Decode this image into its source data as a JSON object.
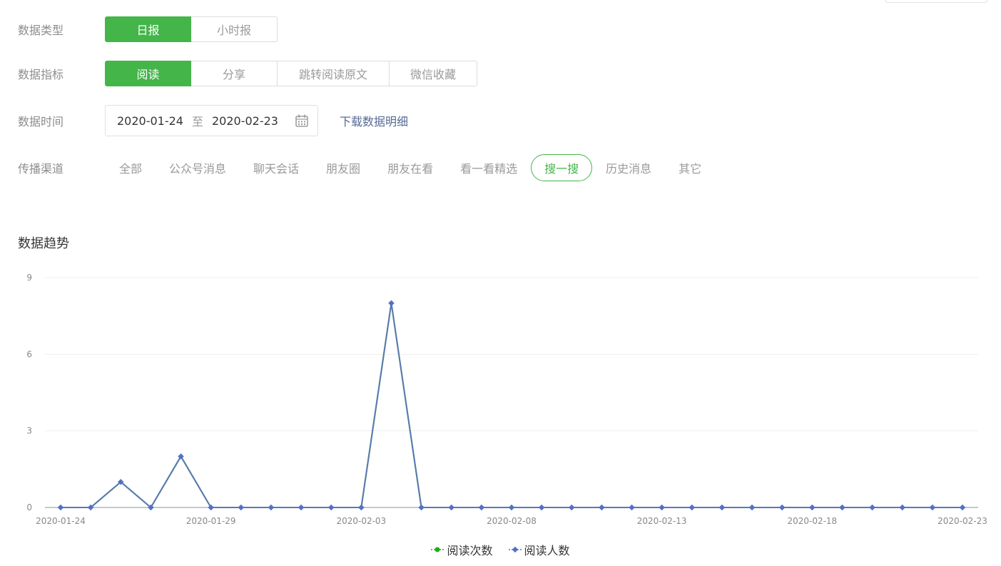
{
  "filters": {
    "data_type": {
      "label": "数据类型",
      "options": [
        "日报",
        "小时报"
      ],
      "active": 0
    },
    "metric": {
      "label": "数据指标",
      "options": [
        "阅读",
        "分享",
        "跳转阅读原文",
        "微信收藏"
      ],
      "active": 0
    },
    "time": {
      "label": "数据时间",
      "start": "2020-01-24",
      "separator": "至",
      "end": "2020-02-23",
      "download_label": "下载数据明细"
    },
    "channel": {
      "label": "传播渠道",
      "options": [
        "全部",
        "公众号消息",
        "聊天会话",
        "朋友圈",
        "朋友在看",
        "看一看精选",
        "搜一搜",
        "历史消息",
        "其它"
      ],
      "active": 6
    }
  },
  "trend": {
    "title": "数据趋势"
  },
  "colors": {
    "accent": "#44b549",
    "link": "#576b95",
    "series_reads": "#1aad19",
    "series_readers": "#5470c6"
  },
  "chart_data": {
    "type": "line",
    "x": [
      "2020-01-24",
      "2020-01-25",
      "2020-01-26",
      "2020-01-27",
      "2020-01-28",
      "2020-01-29",
      "2020-01-30",
      "2020-01-31",
      "2020-02-01",
      "2020-02-02",
      "2020-02-03",
      "2020-02-04",
      "2020-02-05",
      "2020-02-06",
      "2020-02-07",
      "2020-02-08",
      "2020-02-09",
      "2020-02-10",
      "2020-02-11",
      "2020-02-12",
      "2020-02-13",
      "2020-02-14",
      "2020-02-15",
      "2020-02-16",
      "2020-02-17",
      "2020-02-18",
      "2020-02-19",
      "2020-02-20",
      "2020-02-21",
      "2020-02-22",
      "2020-02-23"
    ],
    "xtick_labels": [
      "2020-01-24",
      "2020-01-29",
      "2020-02-03",
      "2020-02-08",
      "2020-02-13",
      "2020-02-18",
      "2020-02-23"
    ],
    "series": [
      {
        "name": "阅读次数",
        "values": [
          0,
          0,
          1,
          0,
          2,
          0,
          0,
          0,
          0,
          0,
          0,
          8,
          0,
          0,
          0,
          0,
          0,
          0,
          0,
          0,
          0,
          0,
          0,
          0,
          0,
          0,
          0,
          0,
          0,
          0,
          0
        ]
      },
      {
        "name": "阅读人数",
        "values": [
          0,
          0,
          1,
          0,
          2,
          0,
          0,
          0,
          0,
          0,
          0,
          8,
          0,
          0,
          0,
          0,
          0,
          0,
          0,
          0,
          0,
          0,
          0,
          0,
          0,
          0,
          0,
          0,
          0,
          0,
          0
        ]
      }
    ],
    "yticks": [
      0,
      3,
      6,
      9
    ],
    "ylim": [
      0,
      9
    ],
    "grid": true,
    "legend": "bottom-center"
  }
}
